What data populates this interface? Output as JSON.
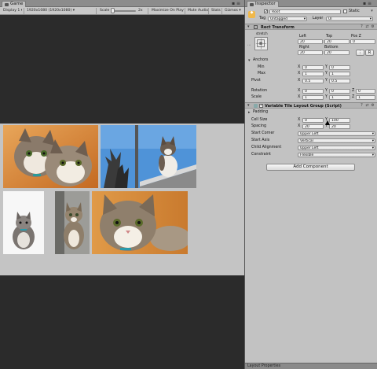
{
  "game_panel": {
    "tab_label": "Game",
    "toolbar": {
      "display": "Display 1",
      "resolution": "1920x1080 (1920x1080)",
      "scale_label": "Scale",
      "scale_value": "2x",
      "maximize_on_play": "Maximize On Play",
      "mute_audio": "Mute Audio",
      "stats": "Stats",
      "gizmos": "Gizmos"
    }
  },
  "inspector": {
    "tab_label": "Inspector",
    "object": {
      "name": "Root",
      "static_label": "Static",
      "tag_label": "Tag",
      "tag_value": "Untagged",
      "layer_label": "Layer",
      "layer_value": "UI"
    },
    "rect_transform": {
      "title": "Rect Transform",
      "stretch_label": "stretch",
      "left_label": "Left",
      "top_label": "Top",
      "posz_label": "Pos Z",
      "left_value": "20",
      "top_value": "20",
      "posz_value": "0",
      "right_label": "Right",
      "bottom_label": "Bottom",
      "right_value": "20",
      "bottom_value": "20",
      "r_button": "R",
      "anchors_label": "Anchors",
      "min_label": "Min",
      "min_x": "0",
      "min_y": "0",
      "max_label": "Max",
      "max_x": "1",
      "max_y": "1",
      "pivot_label": "Pivot",
      "pivot_x": "0.5",
      "pivot_y": "0.5",
      "rotation_label": "Rotation",
      "rot_x": "0",
      "rot_y": "0",
      "rot_z": "0",
      "scale_label": "Scale",
      "scale_x": "1",
      "scale_y": "1",
      "scale_z": "1",
      "x_label": "X",
      "y_label": "Y",
      "z_label": "Z"
    },
    "layout_group": {
      "title": "Variable Tile Layout Group (Script)",
      "padding_label": "Padding",
      "cell_size_label": "Cell Size",
      "cell_x": "0",
      "cell_y": "100",
      "spacing_label": "Spacing",
      "spacing_x": "20",
      "spacing_y": "20",
      "start_corner_label": "Start Corner",
      "start_corner_value": "Upper Left",
      "start_axis_label": "Start Axis",
      "start_axis_value": "Vertical",
      "child_alignment_label": "Child Alignment",
      "child_alignment_value": "Upper Left",
      "constraint_label": "Constraint",
      "constraint_value": "Flexible"
    },
    "add_component_label": "Add Component",
    "status_bar": "Layout Properties"
  }
}
